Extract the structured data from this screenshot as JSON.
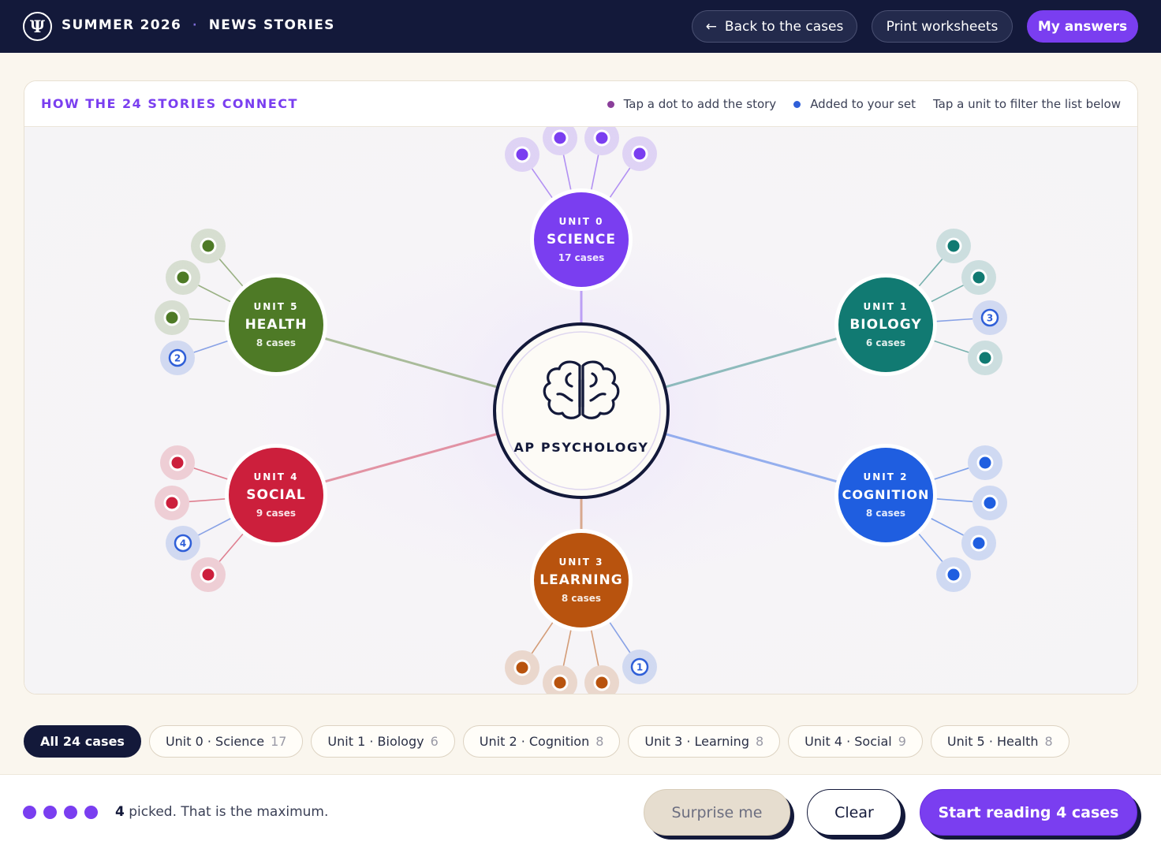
{
  "header": {
    "logo_glyph": "Ψ",
    "term": "SUMMER 2026",
    "separator": "·",
    "section": "NEWS STORIES",
    "back_label": "Back to the cases",
    "back_icon": "arrow-left-icon",
    "print_label": "Print worksheets",
    "answers_label": "My answers"
  },
  "map": {
    "title": "HOW THE 24 STORIES CONNECT",
    "legend": {
      "tap_dot": "Tap a dot to add the story",
      "added": "Added to your set",
      "filter_hint": "Tap a unit to filter the list below",
      "tap_color": "#8a3e9a",
      "added_color": "#2f5fd8"
    },
    "center": {
      "label": "AP PSYCHOLOGY",
      "icon": "brain-icon"
    },
    "units": [
      {
        "kicker": "UNIT 0",
        "name": "SCIENCE",
        "count": "17 cases",
        "color": "#7a3ef0",
        "stories": [
          {
            "picked": null
          },
          {
            "picked": null
          },
          {
            "picked": null
          },
          {
            "picked": null
          }
        ]
      },
      {
        "kicker": "UNIT 1",
        "name": "BIOLOGY",
        "count": "6 cases",
        "color": "#117a72",
        "stories": [
          {
            "picked": null
          },
          {
            "picked": null
          },
          {
            "picked": "3"
          },
          {
            "picked": null
          }
        ]
      },
      {
        "kicker": "UNIT 2",
        "name": "COGNITION",
        "count": "8 cases",
        "color": "#1f5ee0",
        "stories": [
          {
            "picked": null
          },
          {
            "picked": null
          },
          {
            "picked": null
          },
          {
            "picked": null
          }
        ]
      },
      {
        "kicker": "UNIT 3",
        "name": "LEARNING",
        "count": "8 cases",
        "color": "#b8530e",
        "stories": [
          {
            "picked": null
          },
          {
            "picked": null
          },
          {
            "picked": null
          },
          {
            "picked": "1"
          }
        ]
      },
      {
        "kicker": "UNIT 4",
        "name": "SOCIAL",
        "count": "9 cases",
        "color": "#cc1f3c",
        "stories": [
          {
            "picked": null
          },
          {
            "picked": null
          },
          {
            "picked": "4"
          },
          {
            "picked": null
          }
        ]
      },
      {
        "kicker": "UNIT 5",
        "name": "HEALTH",
        "count": "8 cases",
        "color": "#4e7a26",
        "stories": [
          {
            "picked": null
          },
          {
            "picked": null
          },
          {
            "picked": null
          },
          {
            "picked": "2"
          }
        ]
      }
    ]
  },
  "filters": [
    {
      "label": "All 24 cases",
      "count": ""
    },
    {
      "label": "Unit 0 · Science",
      "count": "17"
    },
    {
      "label": "Unit 1 · Biology",
      "count": "6"
    },
    {
      "label": "Unit 2 · Cognition",
      "count": "8"
    },
    {
      "label": "Unit 3 · Learning",
      "count": "8"
    },
    {
      "label": "Unit 4 · Social",
      "count": "9"
    },
    {
      "label": "Unit 5 · Health",
      "count": "8"
    }
  ],
  "footer": {
    "picked_count": "4",
    "picked_text": " picked. That is the maximum.",
    "surprise_label": "Surprise me",
    "clear_label": "Clear",
    "start_label": "Start reading 4 cases"
  }
}
